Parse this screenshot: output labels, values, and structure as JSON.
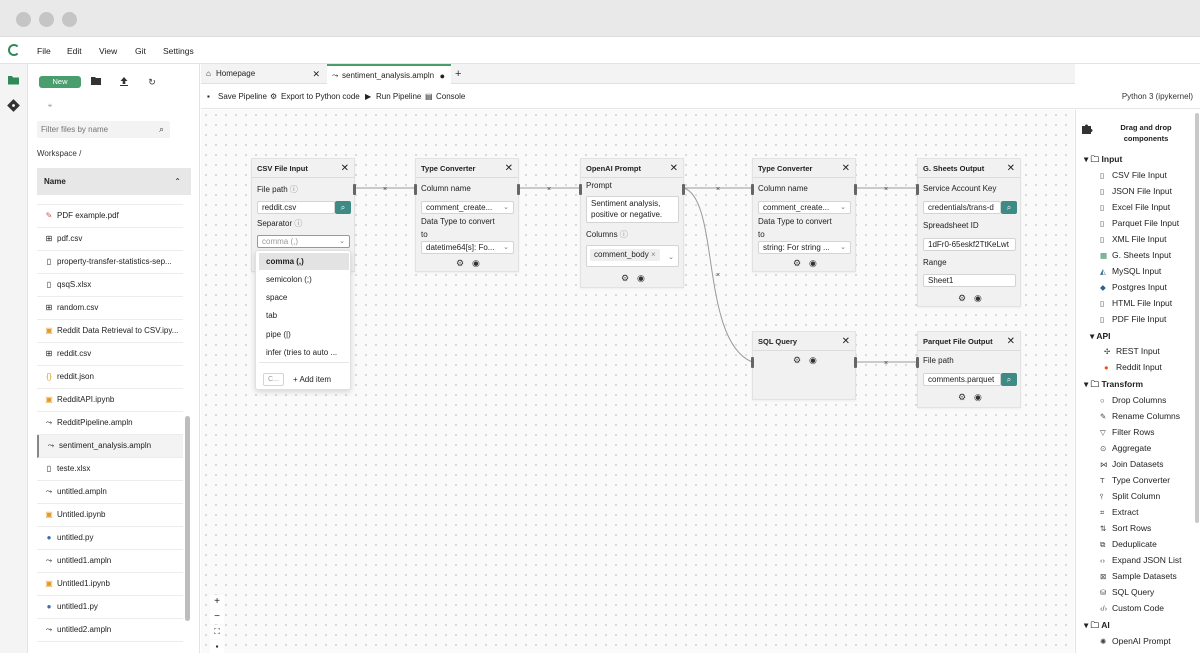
{
  "menu": [
    "File",
    "Edit",
    "View",
    "Git",
    "Settings"
  ],
  "filebrowser": {
    "new_label": "New",
    "filter_placeholder": "Filter files by name",
    "breadcrumb": "Workspace /",
    "name_header": "Name",
    "files": [
      {
        "name": "PDF example.pdf",
        "icon": "pdf-icon"
      },
      {
        "name": "pdf.csv",
        "icon": "table-icon"
      },
      {
        "name": "property-transfer-statistics-sep...",
        "icon": "file-icon"
      },
      {
        "name": "qsqS.xlsx",
        "icon": "file-icon"
      },
      {
        "name": "random.csv",
        "icon": "table-icon"
      },
      {
        "name": "Reddit Data Retrieval to CSV.ipy...",
        "icon": "notebook-icon"
      },
      {
        "name": "reddit.csv",
        "icon": "table-icon"
      },
      {
        "name": "reddit.json",
        "icon": "json-icon"
      },
      {
        "name": "RedditAPI.ipynb",
        "icon": "notebook-icon"
      },
      {
        "name": "RedditPipeline.ampln",
        "icon": "pipeline-icon"
      },
      {
        "name": "sentiment_analysis.ampln",
        "icon": "pipeline-icon"
      },
      {
        "name": "teste.xlsx",
        "icon": "file-icon"
      },
      {
        "name": "untitled.ampln",
        "icon": "pipeline-icon"
      },
      {
        "name": "Untitled.ipynb",
        "icon": "notebook-icon"
      },
      {
        "name": "untitled.py",
        "icon": "python-icon"
      },
      {
        "name": "untitled1.ampln",
        "icon": "pipeline-icon"
      },
      {
        "name": "Untitled1.ipynb",
        "icon": "notebook-icon"
      },
      {
        "name": "untitled1.py",
        "icon": "python-icon"
      },
      {
        "name": "untitled2.ampln",
        "icon": "pipeline-icon"
      }
    ]
  },
  "tabs": [
    {
      "label": "Homepage"
    },
    {
      "label": "sentiment_analysis.ampln"
    }
  ],
  "toolbar": {
    "save": "Save Pipeline",
    "export": "Export to Python code",
    "run": "Run Pipeline",
    "console": "Console",
    "kernel": "Python 3 (ipykernel)"
  },
  "nodes": {
    "csv": {
      "title": "CSV File Input",
      "file_path_label": "File path",
      "file_path_value": "reddit.csv",
      "separator_label": "Separator",
      "separator_placeholder": "comma (,)"
    },
    "type1": {
      "title": "Type Converter",
      "column_label": "Column name",
      "column_value": "comment_create...",
      "dtype_label_1": "Data Type to convert",
      "dtype_label_2": "to",
      "dtype_value": "datetime64[s]: Fo..."
    },
    "openai": {
      "title": "OpenAI Prompt",
      "prompt_label": "Prompt",
      "prompt_value": "Sentiment analysis, positive or negative.",
      "columns_label": "Columns",
      "columns_tag": "comment_body"
    },
    "type2": {
      "title": "Type Converter",
      "column_label": "Column name",
      "column_value": "comment_create...",
      "dtype_label_1": "Data Type to convert",
      "dtype_label_2": "to",
      "dtype_value": "string: For string ..."
    },
    "gsheets": {
      "title": "G. Sheets Output",
      "account_label": "Service Account Key",
      "account_value": "credentials/trans-d",
      "sheet_id_label": "Spreadsheet ID",
      "sheet_id_value": "1dFr0-65eskf2TtKeLwt",
      "range_label": "Range",
      "range_value": "Sheet1"
    },
    "sql": {
      "title": "SQL Query"
    },
    "parquet": {
      "title": "Parquet File Output",
      "file_path_label": "File path",
      "file_path_value": "comments.parquet"
    }
  },
  "dropdown": {
    "options": [
      "comma (,)",
      "semicolon (;)",
      "space",
      "tab",
      "pipe (|)",
      "infer (tries to auto ..."
    ],
    "create_placeholder": "C...",
    "add_item": "Add item"
  },
  "palette": {
    "title": "Drag and drop components",
    "categories": [
      {
        "name": "Input",
        "items": [
          "CSV File Input",
          "JSON File Input",
          "Excel File Input",
          "Parquet File Input",
          "XML File Input",
          "G. Sheets Input",
          "MySQL Input",
          "Postgres Input",
          "HTML File Input",
          "PDF File Input"
        ]
      },
      {
        "name": "API",
        "items": [
          "REST Input",
          "Reddit Input"
        ]
      },
      {
        "name": "Transform",
        "items": [
          "Drop Columns",
          "Rename Columns",
          "Filter Rows",
          "Aggregate",
          "Join Datasets",
          "Type Converter",
          "Split Column",
          "Extract",
          "Sort Rows",
          "Deduplicate",
          "Expand JSON List",
          "Sample Datasets",
          "SQL Query",
          "Custom Code"
        ]
      },
      {
        "name": "AI",
        "items": [
          "OpenAI Prompt"
        ]
      }
    ]
  },
  "colors": {
    "accent": "#4a9d6c",
    "button_teal": "#3e8a84"
  }
}
